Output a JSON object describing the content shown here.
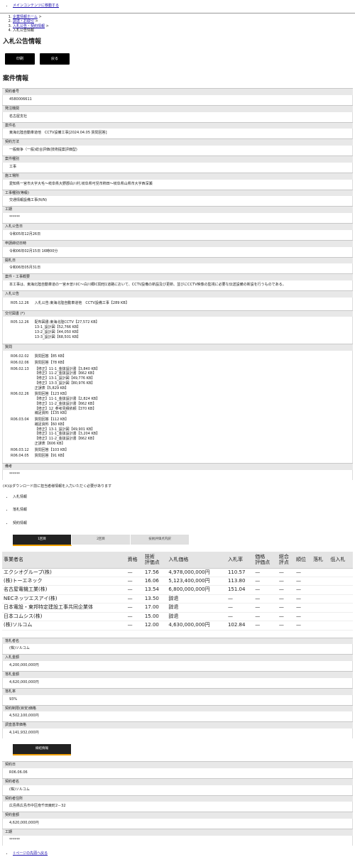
{
  "skip_link": "メインコンテンツに移動する",
  "breadcrumbs": [
    "企業情報ホーム",
    "調達・お取引",
    "入札公告・契約情報",
    "入札公告情報"
  ],
  "page_title": "入札公告情報",
  "buttons": {
    "print": "印刷",
    "back": "戻る"
  },
  "section_title": "案件情報",
  "fields": [
    {
      "label": "契約番号",
      "value": "4580006611"
    },
    {
      "label": "発注機関",
      "value": "名古屋支社"
    },
    {
      "label": "案件名",
      "value": "東海北陸自動車道他　CCTV設備工事[2024.04.05 質問回答]"
    },
    {
      "label": "契約方法",
      "value": "一般競争（一般)総合評価(技術提案評価型)"
    },
    {
      "label": "案件種別",
      "value": "工事"
    },
    {
      "label": "施工場所",
      "value": "愛知県一宮市大字大毛～岐阜県大野郡白川村,岐阜県可児市柿田～岐阜県山県市大字西深瀬"
    },
    {
      "label": "工事種別(等級)",
      "value": "交通情報設備工事(N/N)"
    },
    {
      "label": "工期",
      "value": "******"
    },
    {
      "label": "入札公告日",
      "value": "令和05年12月26日"
    },
    {
      "label": "申請締切日時",
      "value": "令和06年02月15日 16時00分"
    },
    {
      "label": "開札日",
      "value": "令和06年05月31日"
    },
    {
      "label": "案件・工事概要",
      "value": "本工事は、東海北陸自動車道の一宮木曽川IC～白川郷IC間他1道路において、CCTV設備の新設及び更新、並びにCCTV映像の監視に必要な伝送設備の新設を行うものである。"
    }
  ],
  "koukoku": {
    "label": "入札公告",
    "rows": [
      {
        "date": "R05.12.26",
        "text": "入札公告:東海北陸自動車道他　CCTV設備工事【289 KB】"
      }
    ]
  },
  "koufu": {
    "label": "交付図書 (*)",
    "rows": [
      {
        "date": "R05.12.26",
        "text": "配布図書:東海北陸CCTV【27,572 KB】\n13-1_設計図【52,766 KB】\n13-2_設計図【44,050 KB】\n13-3_設計図【68,501 KB】"
      }
    ]
  },
  "shitsumon": {
    "label": "質問",
    "rows": [
      {
        "date": "R06.02.02",
        "text": "質問回答【85 KB】"
      },
      {
        "date": "R06.02.06",
        "text": "質問回答【78 KB】"
      },
      {
        "date": "R06.02.13",
        "text": "【修正】11-1_金抜設計書【3,840 KB】\n【修正】11-2_金抜設計書【662 KB】\n【修正】13-1_設計図【49,776 KB】\n【修正】13-3_設計図【80,976 KB】\n正誤表【5,829 KB】"
      },
      {
        "date": "R06.02.26",
        "text": "質問回答【123 KB】\n【修正】11-1_金抜設計書【2,824 KB】\n【修正】11-2_金抜設計書【662 KB】\n【修正】12_参考見積依頼【370 KB】\n補足資料【135 KB】"
      },
      {
        "date": "R06.03.04",
        "text": "質問回答【112 KB】\n補足資料【60 KB】\n【修正】13-1_設計図【49,901 KB】\n【修正】11-1_金抜設計書【3,204 KB】\n【修正】11-2_金抜設計書【662 KB】\n正誤表【606 KB】"
      },
      {
        "date": "R06.03.12",
        "text": "質問回答【103 KB】"
      },
      {
        "date": "R06.04.05",
        "text": "質問回答【91 KB】"
      }
    ]
  },
  "bikou": {
    "label": "備考",
    "value": "******"
  },
  "download_note": "(※)はダウンロード前に担当者様情報を入力いただく必要があります",
  "info_links": [
    "入札情報",
    "落札情報",
    "契約情報"
  ],
  "tabs": [
    "1回目",
    "2回目",
    "技術評価点内訳"
  ],
  "table_headers": [
    "事業者名",
    "資格",
    "技術\n評価点",
    "入札価格",
    "入札率",
    "価格\n評価点",
    "総合\n評点",
    "順位",
    "落札",
    "低入札"
  ],
  "table_rows": [
    [
      "エクシオグループ(株)",
      "—",
      "17.56",
      "4,978,000,000円",
      "110.57",
      "—",
      "—",
      "—",
      "",
      ""
    ],
    [
      "(株)トーエネック",
      "—",
      "16.06",
      "5,123,400,000円",
      "113.80",
      "—",
      "—",
      "—",
      "",
      ""
    ],
    [
      "名古屋電機工業(株)",
      "—",
      "13.54",
      "6,800,000,000円",
      "151.04",
      "—",
      "—",
      "—",
      "",
      ""
    ],
    [
      "NECネッツエスアイ(株)",
      "—",
      "13.50",
      "辞退",
      "—",
      "—",
      "—",
      "—",
      "",
      ""
    ],
    [
      "日本電設・東邦特定建設工事共同企業体",
      "—",
      "17.00",
      "辞退",
      "—",
      "—",
      "—",
      "—",
      "",
      ""
    ],
    [
      "日本コムシス(株)",
      "—",
      "15.00",
      "辞退",
      "—",
      "—",
      "—",
      "—",
      "",
      ""
    ],
    [
      "(株)ソルコム",
      "—",
      "12.00",
      "4,630,000,000円",
      "102.84",
      "—",
      "—",
      "—",
      "",
      ""
    ]
  ],
  "award_fields": [
    {
      "label": "落札者名",
      "value": "(株)ソルコム"
    },
    {
      "label": "入札金額",
      "value": "4,200,000,000円"
    },
    {
      "label": "落札金額",
      "value": "4,620,000,000円"
    },
    {
      "label": "落札率",
      "value": "93%"
    },
    {
      "label": "契約制限(目安)価格",
      "value": "4,502,100,000円"
    },
    {
      "label": "調査基準価格",
      "value": "4,141,932,000円"
    }
  ],
  "contract_tab": "締結情報",
  "contract_fields": [
    {
      "label": "契約日",
      "value": "R06.06.06"
    },
    {
      "label": "契約者名",
      "value": "(株)ソルコム"
    },
    {
      "label": "契約者住所",
      "value": "広島県広島市中区南千田東町2－32"
    },
    {
      "label": "契約金額",
      "value": "4,620,000,000円"
    },
    {
      "label": "工期",
      "value": "******"
    }
  ],
  "page_top_link": "ページの先頭へ戻る"
}
